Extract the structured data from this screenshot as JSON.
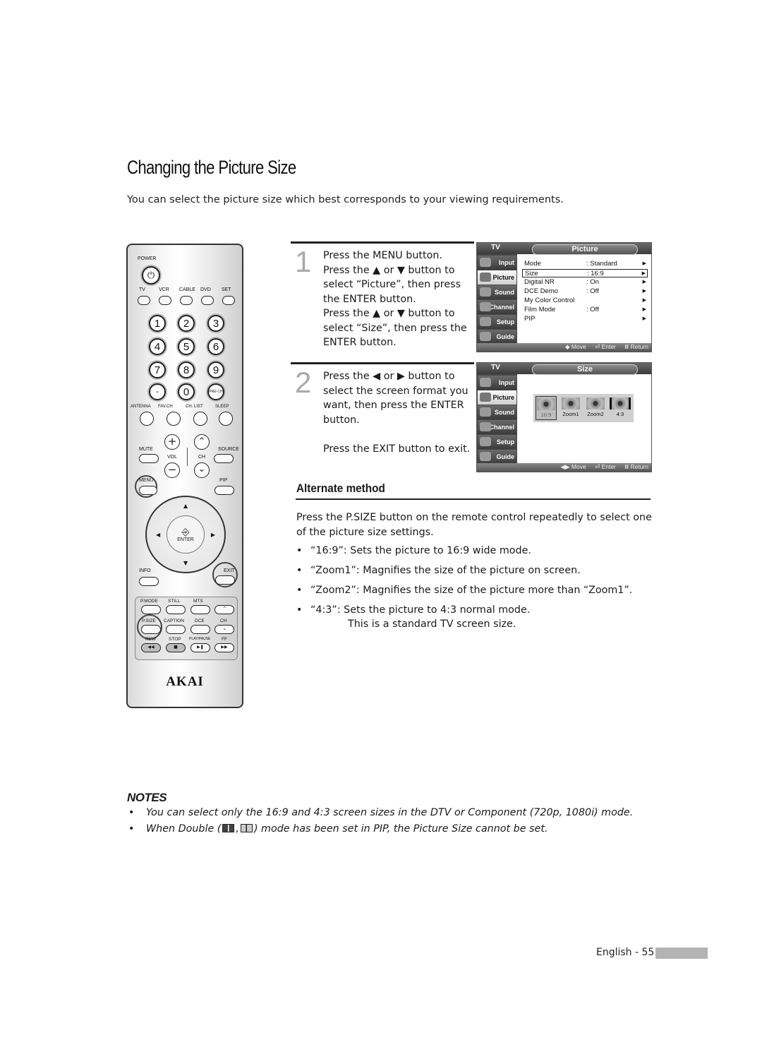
{
  "page": {
    "title": "Changing the Picture Size",
    "intro": "You can select the picture size which best corresponds to your viewing requirements."
  },
  "remote": {
    "brand": "AKAI",
    "power_label": "POWER",
    "source_buttons": [
      "TV",
      "VCR",
      "CABLE",
      "DVD",
      "SET"
    ],
    "number_keys": [
      "1",
      "2",
      "3",
      "4",
      "5",
      "6",
      "7",
      "8",
      "9",
      "-",
      "0",
      "PRE-CH"
    ],
    "function_row": [
      "ANTENNA",
      "FAV.CH",
      "CH. LIST",
      "SLEEP"
    ],
    "mute_label": "MUTE",
    "vol_label": "VOL",
    "ch_label": "CH",
    "source_label": "SOURCE",
    "menu_label": "MENU",
    "pip_label": "PIP",
    "enter_label": "ENTER",
    "info_label": "INFO",
    "exit_label": "EXIT",
    "sub_row1": [
      "P.MODE",
      "STILL",
      "MTS"
    ],
    "sub_row2": [
      "P.SIZE",
      "CAPTION",
      "DCE",
      "CH"
    ],
    "sub_row3": [
      "REW",
      "STOP",
      "PLAY/PAUSE",
      "FF"
    ],
    "plus": "+",
    "minus": "−",
    "up": "⌃",
    "down": "⌄"
  },
  "steps": [
    {
      "number": "1",
      "lines": [
        "Press the MENU button.",
        "Press the ▲ or ▼ button to",
        "select “Picture”, then press",
        "the ENTER button.",
        "Press the ▲ or ▼ button to",
        "select “Size”, then press the",
        "ENTER button."
      ]
    },
    {
      "number": "2",
      "lines": [
        "Press the ◀ or ▶ button to",
        "select the screen format you",
        "want, then press the ENTER",
        "button.",
        "",
        "Press the EXIT button to exit."
      ]
    }
  ],
  "osd_common": {
    "tv_label": "TV",
    "side_items": [
      "Input",
      "Picture",
      "Sound",
      "Channel",
      "Setup",
      "Guide"
    ],
    "active_side": "Picture",
    "footer": {
      "move": "◆ Move",
      "enter": "⏎ Enter",
      "return": "Ⅲ Return"
    },
    "footer_move_lr": "◀▶ Move"
  },
  "osd_picture": {
    "title": "Picture",
    "rows": [
      {
        "label": "Mode",
        "value": ": Standard",
        "arrow": "▶"
      },
      {
        "label": "Size",
        "value": ": 16:9",
        "arrow": "▶",
        "selected": true
      },
      {
        "label": "Digital NR",
        "value": ": On",
        "arrow": "▶"
      },
      {
        "label": "DCE Demo",
        "value": ": Off",
        "arrow": "▶"
      },
      {
        "label": "My Color Control",
        "value": "",
        "arrow": "▶"
      },
      {
        "label": "Film Mode",
        "value": ": Off",
        "arrow": "▶"
      },
      {
        "label": "PIP",
        "value": "",
        "arrow": "▶"
      }
    ]
  },
  "osd_size": {
    "title": "Size",
    "options": [
      "16:9",
      "Zoom1",
      "Zoom2",
      "4:3"
    ],
    "selected": "16:9"
  },
  "alternate": {
    "heading": "Alternate method",
    "paragraph": "Press the P.SIZE button on the remote control repeatedly to select one of the picture size settings.",
    "bullets": [
      {
        "text": "“16:9”: Sets the picture to 16:9 wide mode."
      },
      {
        "text": "“Zoom1”: Magnifies the size of the picture on screen."
      },
      {
        "text": "“Zoom2”: Magnifies the size of the picture more than “Zoom1”."
      },
      {
        "text": "“4:3”: Sets the picture to 4:3 normal mode.",
        "continuation": "This is a standard TV screen size."
      }
    ]
  },
  "notes": {
    "heading": "NOTES",
    "items": [
      {
        "text": "You can select only the 16:9 and 4:3 screen sizes in the DTV or Component (720p, 1080i) mode."
      },
      {
        "before": "When Double (",
        "sep": ",",
        "after": ") mode has been set in PIP, the Picture Size cannot be set."
      }
    ],
    "bullet": "•"
  },
  "footer": {
    "text": "English - 55"
  }
}
